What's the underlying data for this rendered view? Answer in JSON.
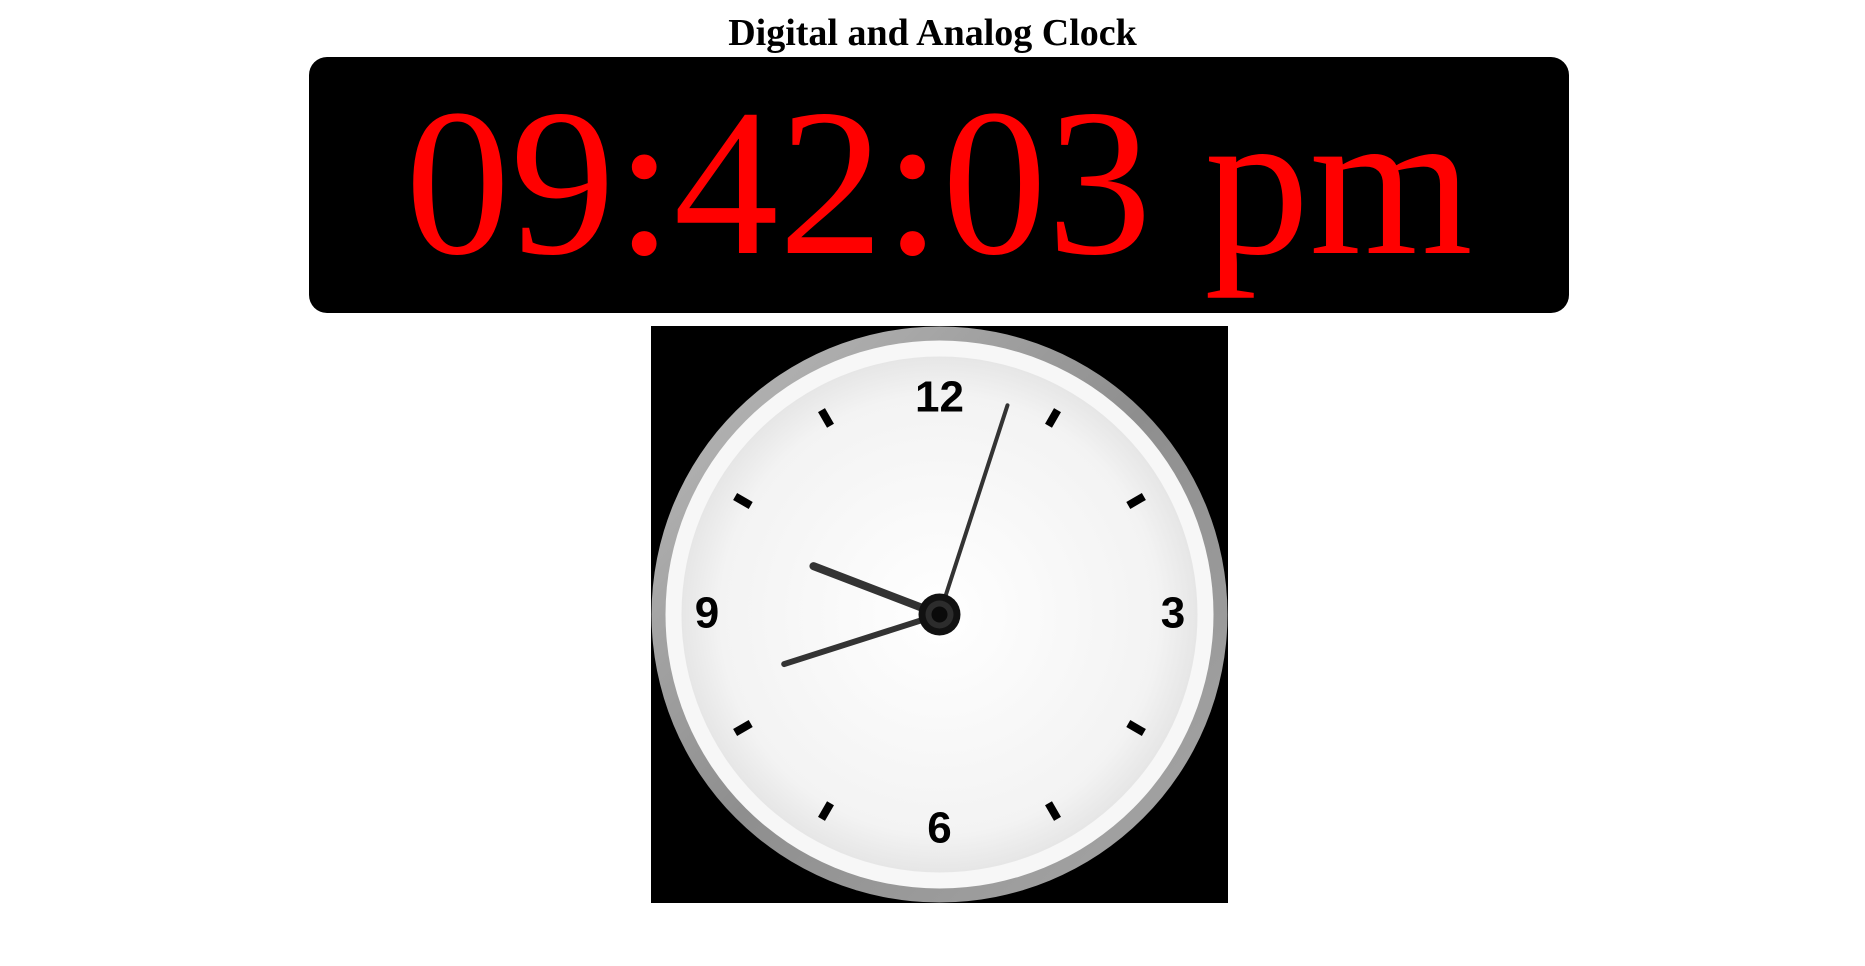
{
  "page": {
    "title": "Digital and Analog Clock"
  },
  "digital_clock": {
    "time_text": "09:42:03 pm",
    "text_color": "#ff0000",
    "background_color": "#000000"
  },
  "analog_clock": {
    "hours": 21,
    "minutes": 42,
    "seconds": 3,
    "numerals": {
      "twelve": "12",
      "three": "3",
      "six": "6",
      "nine": "9"
    },
    "face_color": "#f5f5f5",
    "rim_color": "#9a9a9a",
    "hand_color": "#333333"
  }
}
